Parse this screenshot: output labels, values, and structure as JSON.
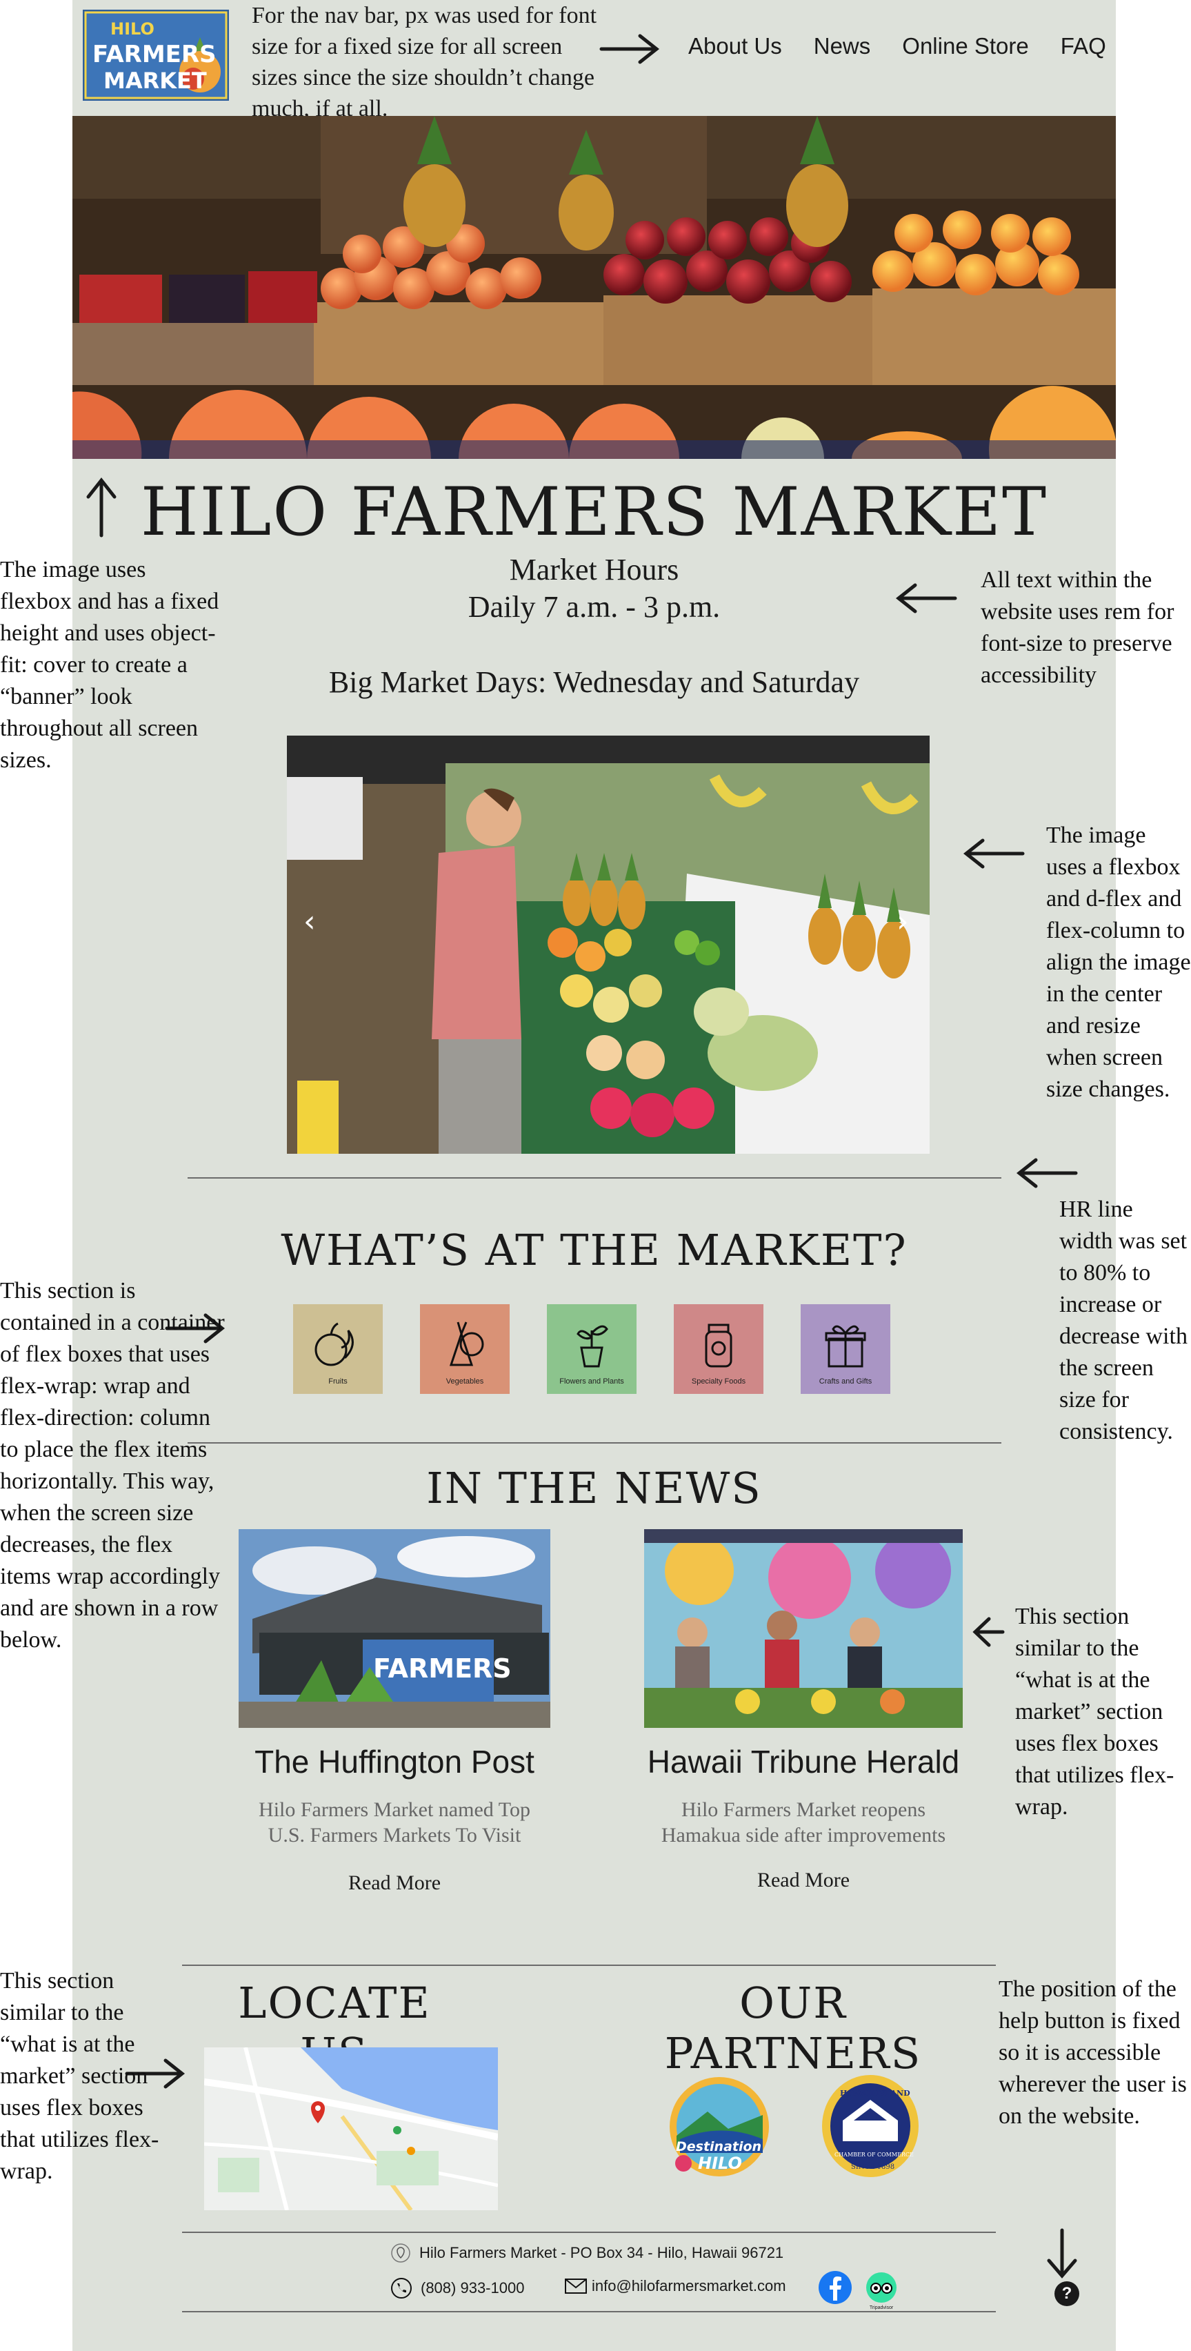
{
  "nav": {
    "logo": {
      "line1": "HILO",
      "line2": "FARMERS",
      "line3": "MARKET"
    },
    "note": "For the nav bar, px was used for font size for a fixed size for all screen sizes since the size shouldn’t change much, if at all.",
    "links": [
      "About Us",
      "News",
      "Online Store",
      "FAQ"
    ]
  },
  "hero": {
    "title": "HILO FARMERS MARKET",
    "hours_label": "Market Hours",
    "hours_time": "Daily 7 a.m. - 3 p.m.",
    "big_days": "Big Market Days: Wednesday and Saturday",
    "carousel_prev": "‹",
    "carousel_next": "›"
  },
  "market_section": {
    "title": "WHAT’S AT THE MARKET?",
    "categories": [
      {
        "label": "Fruits",
        "color": "#cdbf93",
        "icon": "fruit-icon"
      },
      {
        "label": "Vegetables",
        "color": "#d99276",
        "icon": "vegetable-icon"
      },
      {
        "label": "Flowers and Plants",
        "color": "#8cc48d",
        "icon": "plant-icon"
      },
      {
        "label": "Specialty Foods",
        "color": "#cf8888",
        "icon": "jar-icon"
      },
      {
        "label": "Crafts and Gifts",
        "color": "#a995c4",
        "icon": "gift-icon"
      }
    ]
  },
  "news_section": {
    "title": "IN THE NEWS",
    "cards": [
      {
        "source": "The Huffington Post",
        "desc": "Hilo Farmers Market named Top U.S. Farmers Markets To Visit",
        "link": "Read More"
      },
      {
        "source": "Hawaii Tribune Herald",
        "desc": "Hilo Farmers Market reopens Hamakua side after improvements",
        "link": "Read More"
      }
    ]
  },
  "locate": {
    "title": "LOCATE US"
  },
  "partners": {
    "title": "OUR PARTNERS",
    "logo1": {
      "line1": "Destination",
      "line2": "HILO"
    },
    "logo2": {
      "line1": "HAWAII ISLAND",
      "line2": "CHAMBER OF COMMERCE",
      "line3": "SINCE 1898"
    }
  },
  "footer": {
    "address": "Hilo Farmers Market - PO Box 34 - Hilo, Hawaii 96721",
    "phone": "(808) 933-1000",
    "email": "info@hilofarmersmarket.com",
    "tripadvisor": "Tripadvisor"
  },
  "help": {
    "label": "?"
  },
  "annotations": {
    "banner": "The image uses flexbox and has a fixed height and uses object-fit: cover to create a “banner” look throughout all screen sizes.",
    "rem": "All text within the website uses rem for font-size to preserve accessibility",
    "center_image": "The image uses a flexbox and d-flex and flex-column to align the image in the center and resize when screen size changes.",
    "hr": "HR line width was set to 80% to increase or decrease with the screen size for consistency.",
    "flexwrap": "This section is contained in a container of flex boxes that uses flex-wrap: wrap and flex-direction: column to place the flex items horizontally. This way, when the screen size decreases, the flex items wrap accordingly and are shown in a row below.",
    "news": "This section similar to the “what is at the market” section uses flex boxes that utilizes flex-wrap.",
    "locate": "This section similar to the “what is at the market” section uses flex boxes that utilizes flex-wrap.",
    "help": "The position of the help button is fixed so it is accessible wherever the user is on the website."
  }
}
